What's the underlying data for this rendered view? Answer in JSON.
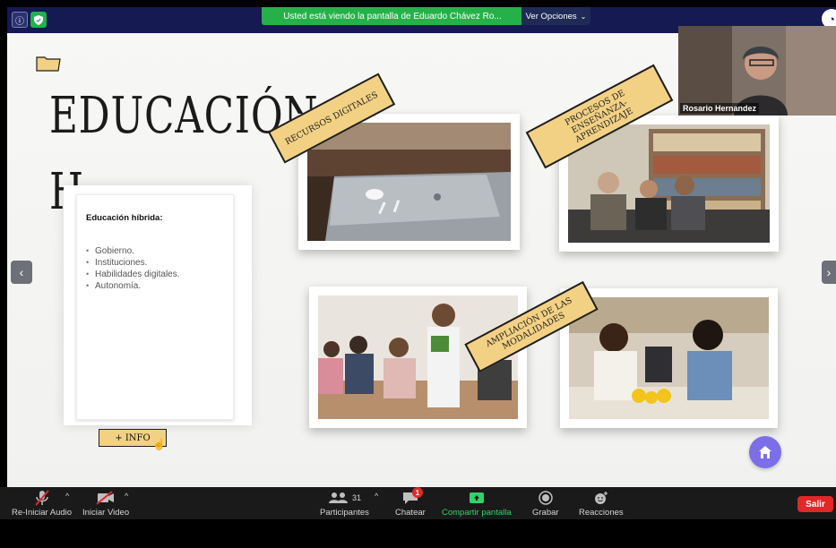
{
  "share_bar": {
    "banner_text": "Usted está viendo la pantalla de Eduardo Chávez Ro...",
    "view_options_label": "Ver Opciones",
    "colors": {
      "banner": "#26b04a",
      "topband": "#151a52"
    }
  },
  "slide": {
    "title_line1": "EDUCACIÓN",
    "title_line2": "H",
    "tags": {
      "resources": "RECURSOS DIGITALES",
      "processes": "PROCESOS DE ENSEÑANZA-APRENDIZAJE",
      "expansion": "AMPLIACIÓN DE LAS MODALIDADES"
    },
    "info_card": {
      "heading": "Educación híbrida:",
      "items": [
        "Gobierno.",
        "Instituciones.",
        "Habilidades digitales.",
        "Autonomía."
      ]
    },
    "more_info_label": "+ INFO",
    "icons": [
      "folder-icon",
      "home-icon",
      "chevron-left-icon",
      "chevron-right-icon"
    ]
  },
  "participant_video": {
    "name": "Rosario Hernandez"
  },
  "toolbar": {
    "audio_label": "Re-Iniciar Audio",
    "video_label": "Iniciar Video",
    "participants_label": "Participantes",
    "participants_count": "31",
    "chat_label": "Chatear",
    "chat_badge": "1",
    "share_label": "Compartir pantalla",
    "record_label": "Grabar",
    "reactions_label": "Reacciones",
    "exit_label": "Salir",
    "colors": {
      "share": "#2fd36b",
      "exit": "#e02828"
    }
  }
}
